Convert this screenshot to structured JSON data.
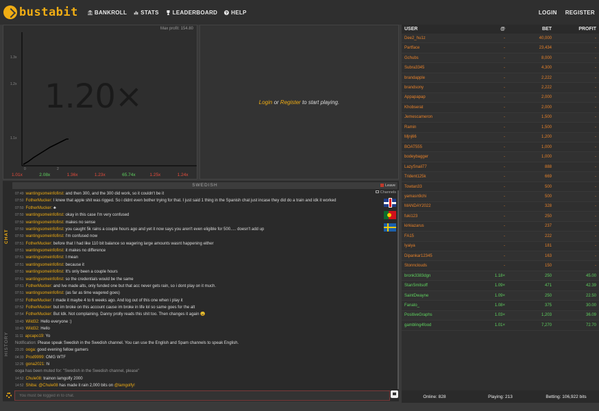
{
  "brand": {
    "name": "bustabit",
    "accent": "#f0ad14"
  },
  "nav": {
    "bankroll": "BANKROLL",
    "stats": "STATS",
    "leaderboard": "LEADERBOARD",
    "help": "HELP",
    "login": "LOGIN",
    "register": "REGISTER"
  },
  "graph": {
    "max_profit": "Max profit: 154.80",
    "multiplier": "1.20×",
    "y_ticks": [
      "1.3x",
      "1.2x",
      "1.1x"
    ],
    "x_ticks": [
      "0",
      "2"
    ],
    "history": [
      {
        "value": "1.01x",
        "color": "#e74c3c"
      },
      {
        "value": "2.08x",
        "color": "#5fd35f"
      },
      {
        "value": "1.36x",
        "color": "#e74c3c"
      },
      {
        "value": "1.23x",
        "color": "#e74c3c"
      },
      {
        "value": "65.74x",
        "color": "#5fd35f"
      },
      {
        "value": "1.25x",
        "color": "#e74c3c"
      },
      {
        "value": "1.24x",
        "color": "#e74c3c"
      }
    ]
  },
  "game": {
    "login": "Login",
    "or": " or ",
    "register": "Register",
    "suffix": " to start playing."
  },
  "chat": {
    "tab_label": "CHAT",
    "history_label": "HISTORY",
    "channel": "SWEDISH",
    "leave": "Leave",
    "channels_label": "Channels",
    "input_placeholder": "You must be logged in to chat.",
    "messages": [
      {
        "t": "07:49",
        "u": "wantingsomeinfofirst:",
        "m": " and then 300, and the 300 did work, so it couldn't be it"
      },
      {
        "t": "07:50",
        "u": "FotherMucker:",
        "m": " I knew that apple shit was rigged. So i didnt even bother trying for that. I just said 1 thing in the Spanish chat just incase they did do a train and idk it worked"
      },
      {
        "t": "07:50",
        "u": "FotherMucker:",
        "m": " ♣"
      },
      {
        "t": "07:50",
        "u": "wantingsomeinfofirst:",
        "m": " okay in this case I'm very confused"
      },
      {
        "t": "07:50",
        "u": "wantingsomeinfofirst:",
        "m": " makes no sense"
      },
      {
        "t": "07:50",
        "u": "wantingsomeinfofirst:",
        "m": " you caught 5k rains a couple hours ago and yet it now says you aren't even eligible for 500..... doesn't add up"
      },
      {
        "t": "07:50",
        "u": "wantingsomeinfofirst:",
        "m": " I'm confused now"
      },
      {
        "t": "07:51",
        "u": "FotherMucker:",
        "m": " before that I had like 110 bit balance so wagering large amounts wasnt happening either"
      },
      {
        "t": "07:51",
        "u": "wantingsomeinfofirst:",
        "m": " it makes no difference"
      },
      {
        "t": "07:51",
        "u": "wantingsomeinfofirst:",
        "m": " I mean"
      },
      {
        "t": "07:51",
        "u": "wantingsomeinfofirst:",
        "m": " because it"
      },
      {
        "t": "07:51",
        "u": "wantingsomeinfofirst:",
        "m": " It's only been a couple hours"
      },
      {
        "t": "07:51",
        "u": "wantingsomeinfofirst:",
        "m": " so the credentials would be the same"
      },
      {
        "t": "07:51",
        "u": "FotherMucker:",
        "m": " and Ive made alts, only funded one but that acc never gets rain, so i dont play on it much."
      },
      {
        "t": "07:51",
        "u": "wantingsomeinfofirst:",
        "m": " (as far as time wagered goes)"
      },
      {
        "t": "07:52",
        "u": "FotherMucker:",
        "m": " I made it maybe 4 to 6 weeks ago. And log out of this one when i play it"
      },
      {
        "t": "07:52",
        "u": "FotherMucker:",
        "m": " but im broke on this account cause im broke in life lol so same goes for the alt"
      },
      {
        "t": "07:54",
        "u": "FotherMucker:",
        "m": " But Idk. Not complaining. Danny prolly reads this shit too. Then changes it again 😩"
      },
      {
        "t": "10:43",
        "u": "Wild32:",
        "m": " Hello everyone :)"
      },
      {
        "t": "10:43",
        "u": "Wild32:",
        "m": " Hello"
      },
      {
        "t": "11:11",
        "u": "apcapo19:",
        "m": " Yo"
      },
      {
        "t": "",
        "u": "",
        "sys": "Notification: ",
        "m": " Please speak Swedish in the Swedish channel. You can use the English and Spam channels to speak English."
      },
      {
        "t": "23:20",
        "u": "ooga:",
        "m": " good evening fellow gamers"
      },
      {
        "t": "04:33",
        "u": "Prod9999:",
        "m": " OMG WTF"
      },
      {
        "t": "12:26",
        "u": "gona2021:",
        "m": " hi"
      },
      {
        "t": "",
        "u": "",
        "sys": "ooga has been muted for: \"Swedish in the Swedish channel, please\"",
        "m": ""
      },
      {
        "t": "14:52",
        "u": "Chule08:",
        "m": " trainon lamgolfy 2000"
      },
      {
        "t": "14:52",
        "u": "Shiba:",
        "m": " ",
        "mention": "@Chule08",
        "rest": " has made it rain 2,000 bits on ",
        "mention2": "@lamgolfy!"
      }
    ]
  },
  "players": {
    "headers": {
      "user": "USER",
      "at": "@",
      "bet": "BET",
      "profit": "PROFIT"
    },
    "rows": [
      {
        "user": "Dee2_hu1z",
        "at": "-",
        "bet": "40,000",
        "profit": "-",
        "state": "pending"
      },
      {
        "user": "Partface",
        "at": "-",
        "bet": "23,434",
        "profit": "-",
        "state": "pending"
      },
      {
        "user": "Gchubs",
        "at": "-",
        "bet": "8,000",
        "profit": "-",
        "state": "pending"
      },
      {
        "user": "Subra3345",
        "at": "-",
        "bet": "4,300",
        "profit": "-",
        "state": "pending"
      },
      {
        "user": "brandapple",
        "at": "-",
        "bet": "2,222",
        "profit": "-",
        "state": "pending"
      },
      {
        "user": "brandsony",
        "at": "-",
        "bet": "2,222",
        "profit": "-",
        "state": "pending"
      },
      {
        "user": "Appapapap",
        "at": "-",
        "bet": "2,000",
        "profit": "-",
        "state": "pending"
      },
      {
        "user": "Khobserat",
        "at": "-",
        "bet": "2,000",
        "profit": "-",
        "state": "pending"
      },
      {
        "user": "Jemescameron",
        "at": "-",
        "bet": "1,500",
        "profit": "-",
        "state": "pending"
      },
      {
        "user": "Ramin",
        "at": "-",
        "bet": "1,500",
        "profit": "-",
        "state": "pending"
      },
      {
        "user": "Mjnj66",
        "at": "-",
        "bet": "1,200",
        "profit": "-",
        "state": "pending"
      },
      {
        "user": "BOAT555",
        "at": "-",
        "bet": "1,000",
        "profit": "-",
        "state": "pending"
      },
      {
        "user": "bodeybagger",
        "at": "-",
        "bet": "1,000",
        "profit": "-",
        "state": "pending"
      },
      {
        "user": "LazySnail77",
        "at": "-",
        "bet": "888",
        "profit": "-",
        "state": "pending"
      },
      {
        "user": "Trident125k",
        "at": "-",
        "bet": "669",
        "profit": "-",
        "state": "pending"
      },
      {
        "user": "Towtan33",
        "at": "-",
        "bet": "500",
        "profit": "-",
        "state": "pending"
      },
      {
        "user": "yamasn9chi",
        "at": "-",
        "bet": "500",
        "profit": "-",
        "state": "pending"
      },
      {
        "user": "MANDAY2022",
        "at": "-",
        "bet": "328",
        "profit": "-",
        "state": "pending"
      },
      {
        "user": "fuki123",
        "at": "-",
        "bet": "250",
        "profit": "-",
        "state": "pending"
      },
      {
        "user": "kirkiazarus",
        "at": "-",
        "bet": "237",
        "profit": "-",
        "state": "pending"
      },
      {
        "user": "FA15",
        "at": "-",
        "bet": "222",
        "profit": "-",
        "state": "pending"
      },
      {
        "user": "Iyaiya",
        "at": "-",
        "bet": "181",
        "profit": "-",
        "state": "pending"
      },
      {
        "user": "Dipankar12345",
        "at": "-",
        "bet": "163",
        "profit": "-",
        "state": "pending"
      },
      {
        "user": "Stonnclouds",
        "at": "-",
        "bet": "150",
        "profit": "-",
        "state": "pending"
      },
      {
        "user": "bronk3383dgn",
        "at": "1.18×",
        "bet": "250",
        "profit": "45.00",
        "state": "cashed"
      },
      {
        "user": "StanSmitsoff",
        "at": "1.09×",
        "bet": "471",
        "profit": "42.39",
        "state": "cashed"
      },
      {
        "user": "SaintDwayne",
        "at": "1.09×",
        "bet": "250",
        "profit": "22.50",
        "state": "cashed"
      },
      {
        "user": "Fanato_",
        "at": "1.08×",
        "bet": "375",
        "profit": "30.00",
        "state": "cashed"
      },
      {
        "user": "PositiveGraphs",
        "at": "1.03×",
        "bet": "1,203",
        "profit": "36.09",
        "state": "cashed"
      },
      {
        "user": "gambling4food",
        "at": "1.01×",
        "bet": "7,270",
        "profit": "72.70",
        "state": "cashed"
      }
    ],
    "footer": {
      "online": "Online: 828",
      "playing": "Playing: 213",
      "betting": "Betting: 106,922 bits"
    }
  }
}
